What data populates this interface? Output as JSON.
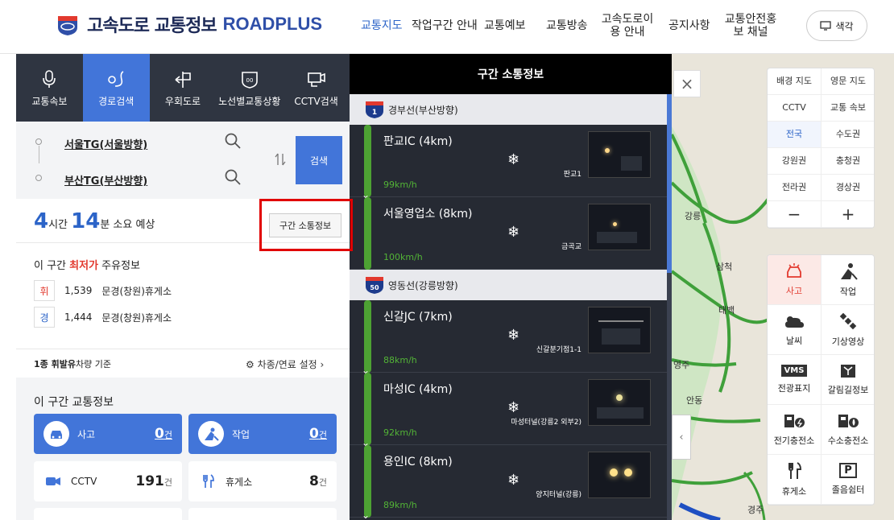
{
  "header": {
    "title_kr": "고속도로 교통정보",
    "title_en": "ROADPLUS",
    "nav": [
      "교통지도",
      "작업구간 안내",
      "교통예보",
      "교통방송",
      "고속도로이용 안내",
      "공지사항",
      "교통안전홍보 채널"
    ],
    "color_btn": "색각"
  },
  "tabs": [
    "교통속보",
    "경로검색",
    "우회도로",
    "노선별교통상황",
    "CCTV검색"
  ],
  "route": {
    "start": "서울TG(서울방향)",
    "end": "부산TG(부산방향)",
    "search": "검색"
  },
  "time": {
    "hours": "4",
    "h_unit": "시간",
    "mins": "14",
    "m_unit": "분 소요 예상"
  },
  "section_btn": "구간 소통정보",
  "lowest": {
    "prefix": "이 구간 ",
    "highlight": "최저가",
    "suffix": " 주유정보",
    "items": [
      {
        "tag": "휘",
        "price": "1,539",
        "place": "문경(창원)휴게소"
      },
      {
        "tag": "경",
        "price": "1,444",
        "place": "문경(창원)휴게소"
      }
    ]
  },
  "basis": {
    "bold": "1종 휘발유",
    "rest": "차량 기준"
  },
  "car_setting": "차종/연료 설정",
  "traffic": {
    "title": "이 구간 교통정보",
    "cards": [
      {
        "label": "사고",
        "num": "0",
        "unit": "건"
      },
      {
        "label": "작업",
        "num": "0",
        "unit": "건"
      },
      {
        "label": "CCTV",
        "num": "191",
        "unit": "건"
      },
      {
        "label": "휴게소",
        "num": "8",
        "unit": "건"
      }
    ]
  },
  "mid": {
    "title": "구간 소통정보",
    "roads": [
      {
        "no": "1",
        "name": "경부선(부산방향)"
      },
      {
        "no": "50",
        "name": "영동선(강릉방향)"
      }
    ],
    "segments": [
      {
        "name": "판교IC (4km)",
        "speed": "99km/h",
        "cam": "판교1"
      },
      {
        "name": "서울영업소 (8km)",
        "speed": "100km/h",
        "cam": "금곡교"
      },
      {
        "name": "신갈JC (7km)",
        "speed": "88km/h",
        "cam": "신갈분기점1-1"
      },
      {
        "name": "마성IC (4km)",
        "speed": "92km/h",
        "cam": "마성터널(강릉2 외부2)"
      },
      {
        "name": "용인IC (8km)",
        "speed": "89km/h",
        "cam": "양지터널(강릉)"
      }
    ]
  },
  "map": {
    "labels": [
      "강릉",
      "삼척",
      "태백",
      "영주",
      "안동",
      "경주"
    ]
  },
  "controls": {
    "grid": [
      "배경 지도",
      "영문 지도",
      "CCTV",
      "교통 속보",
      "전국",
      "수도권",
      "강원권",
      "충청권",
      "전라권",
      "경상권",
      "−",
      "+"
    ],
    "icons": [
      "사고",
      "작업",
      "날씨",
      "기상영상",
      "전광표지",
      "갈림길정보",
      "전기충전소",
      "수소충전소",
      "휴게소",
      "졸음쉼터"
    ],
    "vms": "VMS",
    "parking": "P"
  }
}
